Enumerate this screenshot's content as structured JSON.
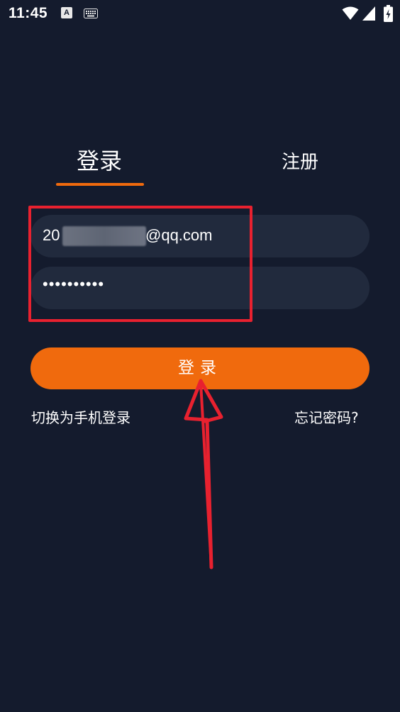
{
  "status_bar": {
    "time": "11:45",
    "notification_icon_letter": "A",
    "icons": [
      "a-notification-icon",
      "keyboard-icon",
      "wifi-icon",
      "signal-icon",
      "battery-icon"
    ]
  },
  "tabs": {
    "login": "登录",
    "register": "注册",
    "active": "login"
  },
  "form": {
    "email_prefix": "20",
    "email_suffix": "@qq.com",
    "password_mask": "••••••••••"
  },
  "login_button": {
    "label": "登录"
  },
  "links": {
    "switch_to_phone": "切换为手机登录",
    "forgot_password": "忘记密码?"
  },
  "colors": {
    "background": "#141b2d",
    "input_background": "#212a3d",
    "accent": "#f06a0d",
    "annotation": "#e8212f"
  }
}
